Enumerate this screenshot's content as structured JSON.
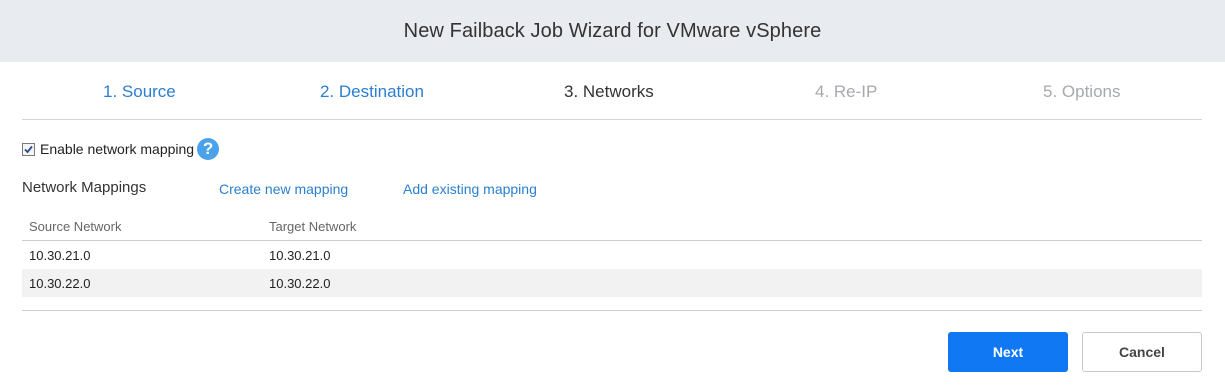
{
  "window": {
    "title": "New Failback Job Wizard for VMware vSphere"
  },
  "steps": [
    {
      "label": "1. Source",
      "state": "done"
    },
    {
      "label": "2. Destination",
      "state": "done"
    },
    {
      "label": "3. Networks",
      "state": "current"
    },
    {
      "label": "4. Re-IP",
      "state": "pending"
    },
    {
      "label": "5. Options",
      "state": "pending"
    }
  ],
  "networks": {
    "enable_label": "Enable network mapping",
    "enable_checked": true,
    "help_icon": "question-mark-icon",
    "mappings_title": "Network Mappings",
    "create_link": "Create new mapping",
    "add_link": "Add existing mapping",
    "table": {
      "columns": [
        "Source Network",
        "Target Network"
      ],
      "rows": [
        [
          "10.30.21.0",
          "10.30.21.0"
        ],
        [
          "10.30.22.0",
          "10.30.22.0"
        ]
      ]
    }
  },
  "footer": {
    "next_label": "Next",
    "cancel_label": "Cancel"
  },
  "colors": {
    "link": "#2a7fd1",
    "primary_button": "#0f78f2",
    "help_icon": "#4aa3ea",
    "title_bar": "#e8ebf0"
  }
}
